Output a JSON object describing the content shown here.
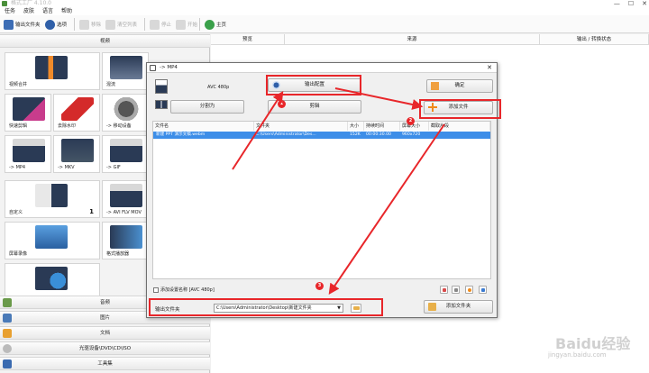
{
  "window": {
    "title": "格式工厂 4.10.0",
    "controls": [
      "—",
      "☐",
      "✕"
    ]
  },
  "menu": [
    "任务",
    "皮肤",
    "语言",
    "帮助"
  ],
  "toolbar": {
    "output_folder": "输出文件夹",
    "options": "选项",
    "remove": "移除",
    "clear_list": "清空列表",
    "stop": "停止",
    "start": "开始",
    "home": "主页"
  },
  "left": {
    "video_header": "视频",
    "tiles": [
      {
        "label": "视频合并",
        "icon": "film-plus-icon"
      },
      {
        "label": "混流",
        "icon": "mux-icon"
      },
      {
        "label": "快速剪辑",
        "icon": "scissors-icon"
      },
      {
        "label": "去除水印",
        "icon": "eraser-icon"
      },
      {
        "label": "-> 移动设备",
        "icon": "film-reel-icon"
      },
      {
        "label": "-> MP4",
        "icon": "mp4-icon",
        "badge": "MP4"
      },
      {
        "label": "-> MKV",
        "icon": "mkv-icon"
      },
      {
        "label": "-> GIF",
        "icon": "gif-icon",
        "badge": "GIF"
      },
      {
        "label": "自定义",
        "icon": "custom-icon",
        "count": "1"
      },
      {
        "label": "-> AVI FLV MOV",
        "icon": "avi-icon",
        "badge": "AVI FLV MOV"
      },
      {
        "label": "屏幕录像",
        "icon": "screen-record-icon"
      },
      {
        "label": "格式播放器",
        "icon": "player-icon"
      },
      {
        "label": "",
        "icon": "video-globe-icon"
      }
    ],
    "categories": [
      "音频",
      "图片",
      "文档",
      "光驱设备\\DVD\\CD\\ISO",
      "工具集"
    ]
  },
  "main": {
    "columns": [
      "预览",
      "来源",
      "输出 / 转换状态"
    ]
  },
  "dialog": {
    "title": "-> MP4",
    "format_text": "AVC 480p",
    "output_config": "输出配置",
    "confirm": "确定",
    "split": "分割为",
    "edit": "剪辑",
    "add_file": "添加文件",
    "table_headers": [
      "文件名",
      "文件夹",
      "大小",
      "持续时间",
      "屏幕大小",
      "截取片段"
    ],
    "row": {
      "name": "新建 PPT 演示文稿.webm",
      "folder": "C:\\Users\\Administrator\\Des...",
      "size": "152K",
      "duration": "00:00:30.00",
      "screen": "960x720",
      "clip": ""
    },
    "add_setting_name": "添加设置名称 [AVC 480p]",
    "output_folder_label": "输出文件夹",
    "output_folder_value": "C:\\Users\\Administrator\\Desktop\\新建文件夹",
    "add_folder": "添加文件夹",
    "markers": [
      "1",
      "2",
      "3"
    ]
  },
  "watermark": {
    "text": "Baidu经验",
    "url": "jingyan.baidu.com"
  },
  "colors": {
    "annotation": "#e8262a",
    "selection": "#3d8ee8"
  }
}
